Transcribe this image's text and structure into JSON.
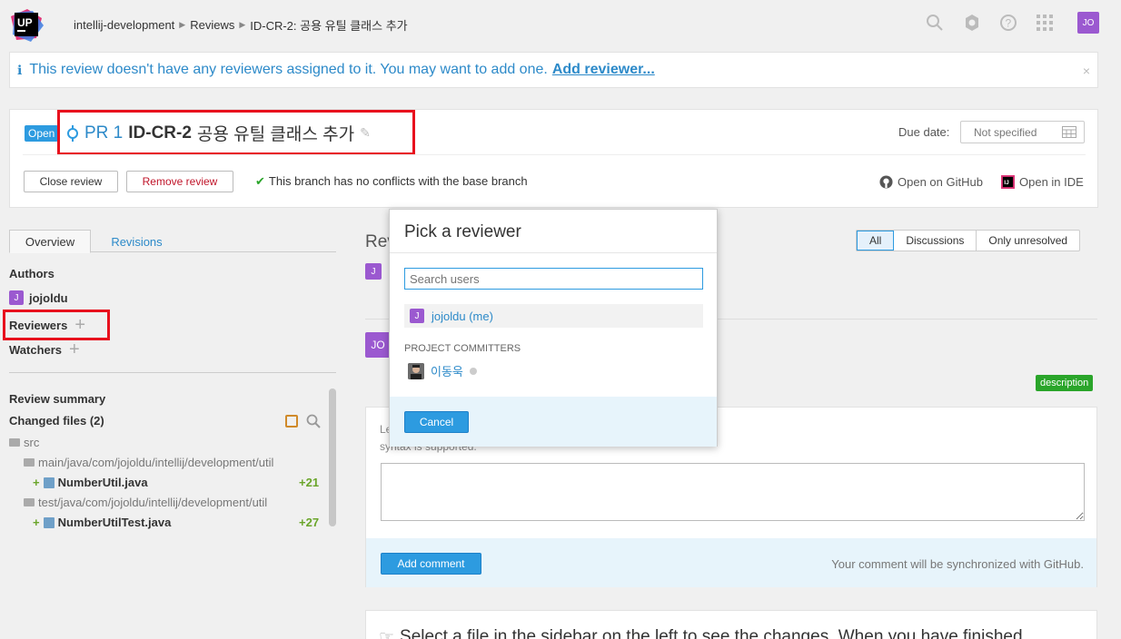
{
  "header": {
    "logo_text": "UP",
    "breadcrumb": [
      "intellij-development",
      "Reviews",
      "ID-CR-2: 공용 유틸 클래스 추가"
    ],
    "avatar": "JO"
  },
  "info_bar": {
    "text": "This review doesn't have any reviewers assigned to it. You may want to add one.",
    "link": "Add reviewer...",
    "close": "×"
  },
  "review": {
    "status": "Open",
    "pr": "PR 1",
    "id": "ID-CR-2",
    "title": "공용 유틸 클래스 추가",
    "due_label": "Due date:",
    "due_value": "Not specified",
    "close_btn": "Close review",
    "remove_btn": "Remove review",
    "conflict_text": "This branch has no conflicts with the base branch",
    "github_link": "Open on GitHub",
    "ide_link": "Open in IDE"
  },
  "sidebar": {
    "tabs": [
      "Overview",
      "Revisions"
    ],
    "authors_label": "Authors",
    "author": "jojoldu",
    "author_avatar": "J",
    "reviewers_label": "Reviewers",
    "watchers_label": "Watchers",
    "summary_label": "Review summary",
    "changed_files_label": "Changed files (2)",
    "tree": {
      "root": "src",
      "dirs": [
        {
          "path": "main/java/com/jojoldu/intellij/development/util",
          "file": "NumberUtil.java",
          "adds": "+21"
        },
        {
          "path": "test/java/com/jojoldu/intellij/development/util",
          "file": "NumberUtilTest.java",
          "adds": "+27"
        }
      ]
    }
  },
  "main": {
    "heading_partial": "Rev",
    "filters": [
      "All",
      "Discussions",
      "Only unresolved"
    ],
    "avatar_j": "J",
    "avatar_jo": "JO",
    "description_badge": "description",
    "hint_partial_1": "Le",
    "hint_partial_2": "syntax is supported.",
    "add_comment": "Add comment",
    "sync_note": "Your comment will be synchronized with GitHub.",
    "bottom_text": "Select a file in the sidebar on the left to see the changes. When you have finished"
  },
  "modal": {
    "title": "Pick a reviewer",
    "search_placeholder": "Search users",
    "me": "jojoldu (me)",
    "me_avatar": "J",
    "group": "PROJECT COMMITTERS",
    "committer": "이동욱",
    "cancel": "Cancel"
  }
}
